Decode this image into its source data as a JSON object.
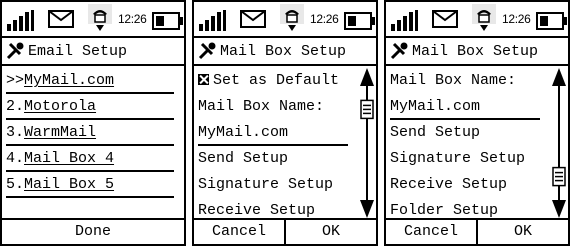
{
  "status": {
    "time": "12:26"
  },
  "screens": [
    {
      "title": "Email Setup",
      "items": [
        {
          "prefix": ">>",
          "label": "MyMail.com"
        },
        {
          "prefix": "2.",
          "label": "Motorola"
        },
        {
          "prefix": "3.",
          "label": "WarmMail"
        },
        {
          "prefix": "4.",
          "label": "Mail Box 4"
        },
        {
          "prefix": "5.",
          "label": "Mail Box 5"
        }
      ],
      "softkeys": [
        "Done"
      ]
    },
    {
      "title": "Mail Box Setup",
      "set_default": "Set as Default",
      "items": [
        "Mail Box Name:",
        "MyMail.com",
        "Send Setup",
        "Signature Setup",
        "Receive Setup"
      ],
      "softkeys": [
        "Cancel",
        "OK"
      ],
      "scroll_position": 0.15
    },
    {
      "title": "Mail Box Setup",
      "items": [
        "Mail Box Name:",
        "MyMail.com",
        "Send Setup",
        "Signature Setup",
        "Receive Setup",
        "Folder Setup"
      ],
      "softkeys": [
        "Cancel",
        "OK"
      ],
      "scroll_position": 0.85
    }
  ]
}
